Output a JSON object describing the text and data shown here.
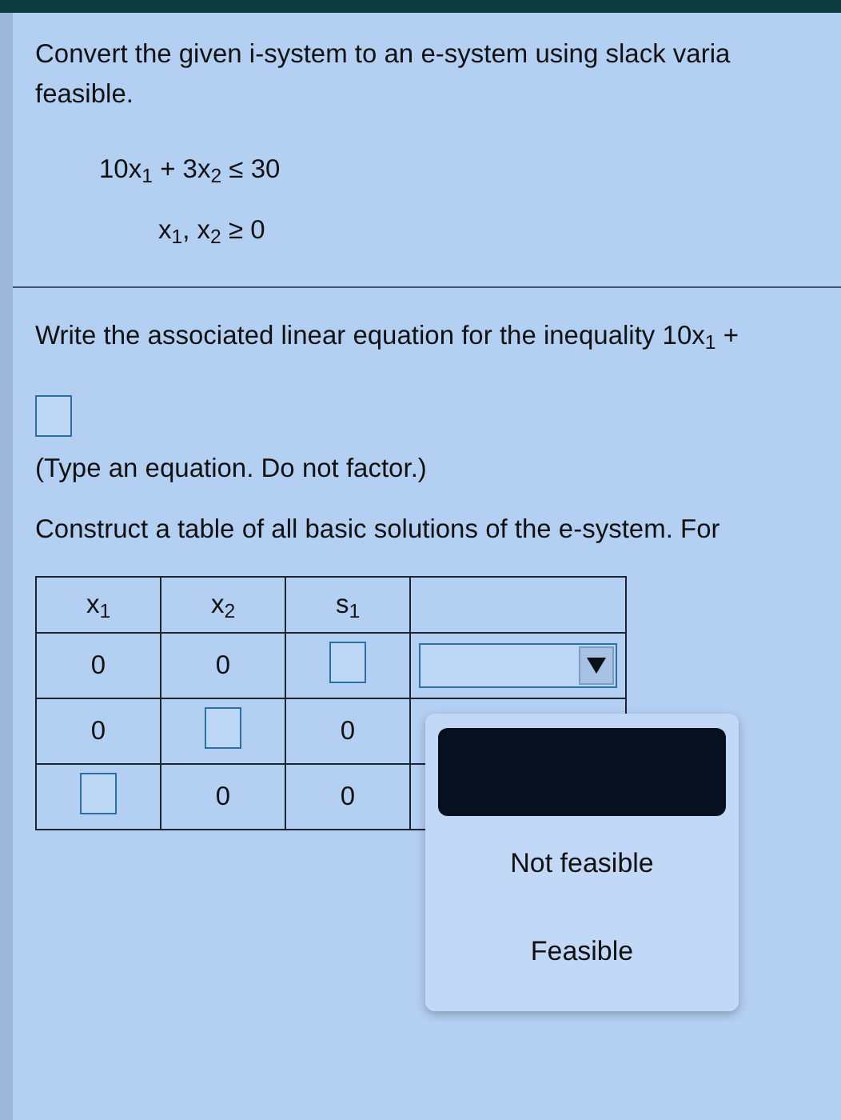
{
  "question": {
    "intro": "Convert the given i-system to an e-system using slack varia",
    "intro_line2": "feasible.",
    "system": [
      "10x$_{1}$ + 3x$_{2}$ ≤ 30",
      "x$_{1}$, x$_{2}$ ≥ 0"
    ]
  },
  "part1": {
    "prompt": "Write the associated linear equation for the inequality 10x$_{1}$ +",
    "hint": "(Type an equation. Do not factor.)"
  },
  "part2": {
    "prompt": "Construct a table of all basic solutions of the e-system. For",
    "table": {
      "columns": [
        "x$_{1}$",
        "x$_{2}$",
        "s$_{1}$"
      ],
      "rows": [
        {
          "cells": [
            {
              "kind": "value",
              "text": "0"
            },
            {
              "kind": "value",
              "text": "0"
            },
            {
              "kind": "input"
            },
            {
              "kind": "dropdown"
            }
          ]
        },
        {
          "cells": [
            {
              "kind": "value",
              "text": "0"
            },
            {
              "kind": "input"
            },
            {
              "kind": "value",
              "text": "0"
            },
            {
              "kind": "hidden"
            }
          ]
        },
        {
          "cells": [
            {
              "kind": "input"
            },
            {
              "kind": "value",
              "text": "0"
            },
            {
              "kind": "value",
              "text": "0"
            },
            {
              "kind": "hidden"
            }
          ]
        }
      ]
    },
    "dropdown_menu": {
      "expanded": true,
      "options": [
        {
          "kind": "blank",
          "selected": true
        },
        {
          "kind": "text",
          "label": "Not feasible",
          "selected": false
        },
        {
          "kind": "text",
          "label": "Feasible",
          "selected": false
        }
      ]
    }
  }
}
